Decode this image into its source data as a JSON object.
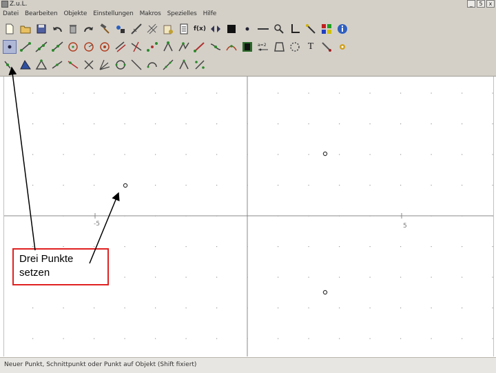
{
  "window": {
    "title": "Z.u.L.",
    "buttons": [
      "_",
      "5",
      "x"
    ]
  },
  "menu": {
    "items": [
      "Datei",
      "Bearbeiten",
      "Objekte",
      "Einstellungen",
      "Makros",
      "Spezielles",
      "Hilfe"
    ]
  },
  "toolbar": {
    "row1": [
      "new-file-icon",
      "open-file-icon",
      "save-icon",
      "undo-icon",
      "delete-icon",
      "redo-icon",
      "hammer-icon",
      "color-icon",
      "ruler-icon",
      "grid-icon",
      "clipboard-icon",
      "function-icon",
      "arrows-icon",
      "black-square-icon",
      "point-style-icon",
      "line-style-icon",
      "zoom-icon",
      "axes-icon",
      "wand-icon",
      "palette-icon",
      "info-icon"
    ],
    "row2": [
      "point-icon",
      "segment-icon",
      "line-icon",
      "ray-icon",
      "circle-icon",
      "circle-radius-icon",
      "circle-fixed-icon",
      "parallel-icon",
      "perpendicular-icon",
      "midpoint-icon",
      "angle-icon",
      "polygon-icon",
      "vector-icon",
      "intersection-icon",
      "conic-icon",
      "film-icon",
      "expression-icon",
      "quadrilateral-icon",
      "curve-icon",
      "text-icon",
      "hammer-icon",
      "star-icon"
    ],
    "row3": [
      "point-on-object-icon",
      "triangle-icon",
      "triangle2-icon",
      "segment-fixed-icon",
      "line-fixed-icon",
      "cross-icon",
      "bisector-icon",
      "circle-three-icon",
      "slash-icon",
      "circle-arc-icon",
      "segment-points-icon",
      "line-points-icon",
      "fraction-icon"
    ],
    "function_label": "f(x)",
    "text_label": "T"
  },
  "canvas": {
    "axis_label_x": "5",
    "axis_label_x_neg": "-5"
  },
  "callout": {
    "text": "Drei Punkte\nsetzen",
    "border_color": "#e02020"
  },
  "status": {
    "text": "Neuer Punkt, Schnittpunkt oder Punkt auf Objekt (Shift fixiert)"
  }
}
